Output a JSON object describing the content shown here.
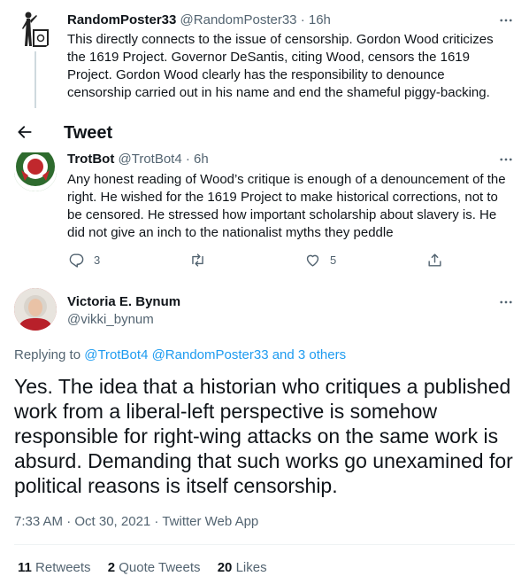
{
  "header": {
    "title": "Tweet"
  },
  "tweets": [
    {
      "name": "RandomPoster33",
      "handle": "@RandomPoster33",
      "separator": "·",
      "time": "16h",
      "text": "This directly connects to the issue of censorship. Gordon Wood criticizes the 1619 Project. Governor DeSantis, citing Wood, censors the 1619 Project. Gordon Wood clearly has the responsibility to denounce censorship carried out in his name and end the shameful piggy-backing."
    },
    {
      "name": "TrotBot",
      "handle": "@TrotBot4",
      "separator": "·",
      "time": "6h",
      "text": "Any honest reading of Wood’s critique is enough of a denouncement of the right. He wished for the 1619 Project to make historical corrections, not to be censored. He stressed how important scholarship about slavery is. He did not give an inch to the nationalist myths they peddle",
      "actions": {
        "replies": "3",
        "retweets": "",
        "likes": "5"
      }
    }
  ],
  "main_tweet": {
    "name": "Victoria E. Bynum",
    "handle": "@vikki_bynum",
    "replying_prefix": "Replying to",
    "replying_to": "@TrotBot4 @RandomPoster33 and 3 others",
    "text": "Yes. The idea that a historian who critiques a published work from a liberal-left perspective is somehow responsible for right-wing attacks on the same work is absurd. Demanding that such works go unexamined for political reasons is itself censorship.",
    "meta": "7:33 AM · Oct 30, 2021 · Twitter Web App",
    "stats": [
      {
        "count": "11",
        "label": "Retweets"
      },
      {
        "count": "2",
        "label": "Quote Tweets"
      },
      {
        "count": "20",
        "label": "Likes"
      }
    ]
  },
  "icons": {
    "more": "more-horizontal-icon",
    "back": "arrow-left-icon",
    "reply": "reply-icon",
    "retweet": "retweet-icon",
    "like": "heart-icon",
    "share": "share-icon"
  },
  "colors": {
    "link": "#1d9bf0",
    "muted": "#536471",
    "text": "#0f1419"
  }
}
